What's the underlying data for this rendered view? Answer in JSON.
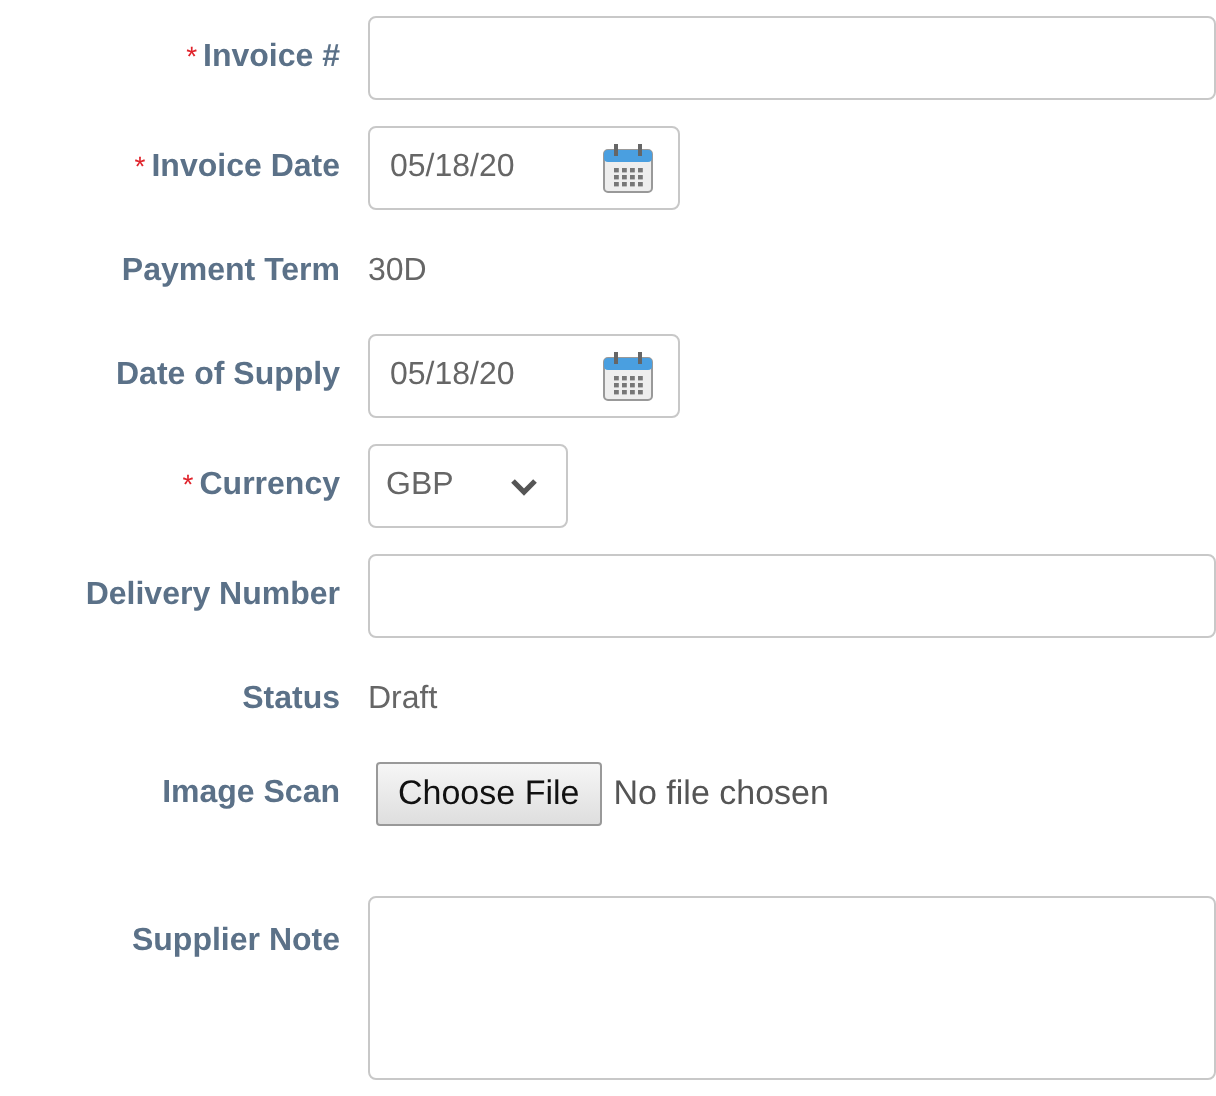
{
  "fields": [
    {
      "kind": "text",
      "label": "Invoice #",
      "marker": "*"
    },
    {
      "kind": "date",
      "label": "Invoice Date",
      "marker": "*",
      "value": "05/18/20"
    },
    {
      "kind": "static",
      "label": "Payment Term",
      "value": "30D"
    },
    {
      "kind": "date",
      "label": "Date of Supply",
      "value": "05/18/20"
    },
    {
      "kind": "select",
      "label": "Currency",
      "marker": "*",
      "value": "GBP"
    },
    {
      "kind": "text",
      "label": "Delivery Number"
    },
    {
      "kind": "static",
      "label": "Status",
      "value": "Draft"
    },
    {
      "kind": "file",
      "label": "Image Scan",
      "button": "Choose File",
      "value": "No file chosen"
    },
    {
      "kind": "textarea",
      "label": "Supplier Note"
    }
  ]
}
